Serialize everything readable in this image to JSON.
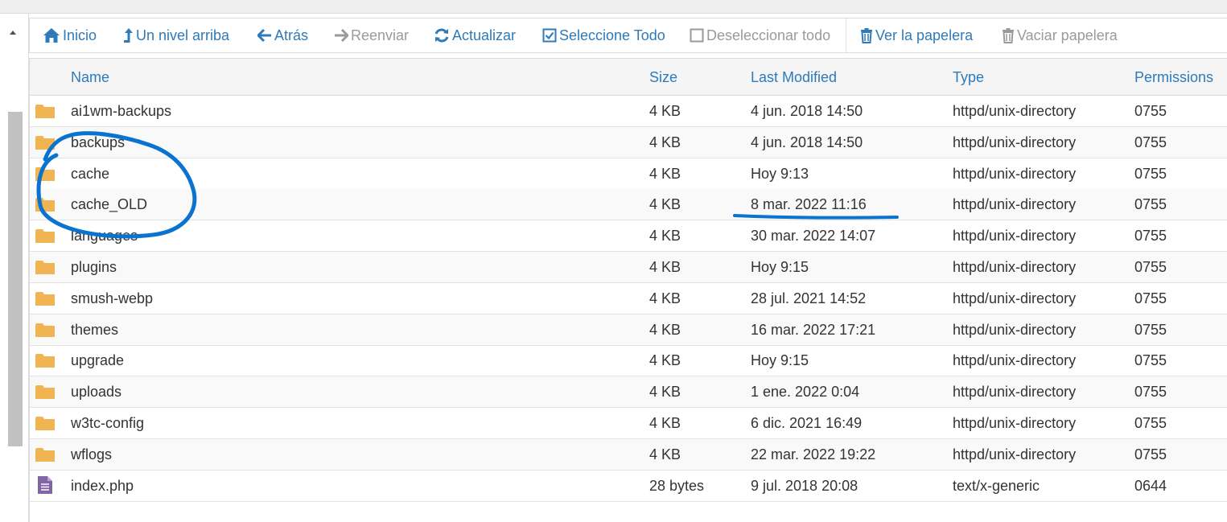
{
  "toolbar": {
    "items": [
      {
        "label": "Inicio",
        "icon": "home-icon",
        "enabled": true
      },
      {
        "label": "Un nivel arriba",
        "icon": "level-up-icon",
        "enabled": true
      },
      {
        "label": "Atrás",
        "icon": "arrow-left-icon",
        "enabled": true
      },
      {
        "label": "Reenviar",
        "icon": "arrow-right-icon",
        "enabled": false
      },
      {
        "label": "Actualizar",
        "icon": "refresh-icon",
        "enabled": true
      },
      {
        "label": "Seleccione Todo",
        "icon": "checkbox-checked-icon",
        "enabled": true
      },
      {
        "label": "Deseleccionar todo",
        "icon": "checkbox-empty-icon",
        "enabled": false
      },
      {
        "label": "Ver la papelera",
        "icon": "trash-icon",
        "enabled": true
      },
      {
        "label": "Vaciar papelera",
        "icon": "trash-icon",
        "enabled": false
      }
    ]
  },
  "table": {
    "columns": [
      "Name",
      "Size",
      "Last Modified",
      "Type",
      "Permissions"
    ],
    "rows": [
      {
        "icon": "folder-icon",
        "name": "ai1wm-backups",
        "size": "4 KB",
        "modified": "4 jun. 2018 14:50",
        "type": "httpd/unix-directory",
        "perms": "0755"
      },
      {
        "icon": "folder-icon",
        "name": "backups",
        "size": "4 KB",
        "modified": "4 jun. 2018 14:50",
        "type": "httpd/unix-directory",
        "perms": "0755"
      },
      {
        "icon": "folder-icon",
        "name": "cache",
        "size": "4 KB",
        "modified": "Hoy 9:13",
        "type": "httpd/unix-directory",
        "perms": "0755"
      },
      {
        "icon": "folder-icon",
        "name": "cache_OLD",
        "size": "4 KB",
        "modified": "8 mar. 2022 11:16",
        "type": "httpd/unix-directory",
        "perms": "0755"
      },
      {
        "icon": "folder-icon",
        "name": "languages",
        "size": "4 KB",
        "modified": "30 mar. 2022 14:07",
        "type": "httpd/unix-directory",
        "perms": "0755"
      },
      {
        "icon": "folder-icon",
        "name": "plugins",
        "size": "4 KB",
        "modified": "Hoy 9:15",
        "type": "httpd/unix-directory",
        "perms": "0755"
      },
      {
        "icon": "folder-icon",
        "name": "smush-webp",
        "size": "4 KB",
        "modified": "28 jul. 2021 14:52",
        "type": "httpd/unix-directory",
        "perms": "0755"
      },
      {
        "icon": "folder-icon",
        "name": "themes",
        "size": "4 KB",
        "modified": "16 mar. 2022 17:21",
        "type": "httpd/unix-directory",
        "perms": "0755"
      },
      {
        "icon": "folder-icon",
        "name": "upgrade",
        "size": "4 KB",
        "modified": "Hoy 9:15",
        "type": "httpd/unix-directory",
        "perms": "0755"
      },
      {
        "icon": "folder-icon",
        "name": "uploads",
        "size": "4 KB",
        "modified": "1 ene. 2022 0:04",
        "type": "httpd/unix-directory",
        "perms": "0755"
      },
      {
        "icon": "folder-icon",
        "name": "w3tc-config",
        "size": "4 KB",
        "modified": "6 dic. 2021 16:49",
        "type": "httpd/unix-directory",
        "perms": "0755"
      },
      {
        "icon": "folder-icon",
        "name": "wflogs",
        "size": "4 KB",
        "modified": "22 mar. 2022 19:22",
        "type": "httpd/unix-directory",
        "perms": "0755"
      },
      {
        "icon": "file-text-icon",
        "name": "index.php",
        "size": "28 bytes",
        "modified": "9 jul. 2018 20:08",
        "type": "text/x-generic",
        "perms": "0644"
      }
    ]
  },
  "colors": {
    "link": "#2f7ab8",
    "disabled": "#9a9a9a",
    "folder": "#f0b552",
    "file": "#8265a4",
    "annotation": "#0a73d0"
  }
}
